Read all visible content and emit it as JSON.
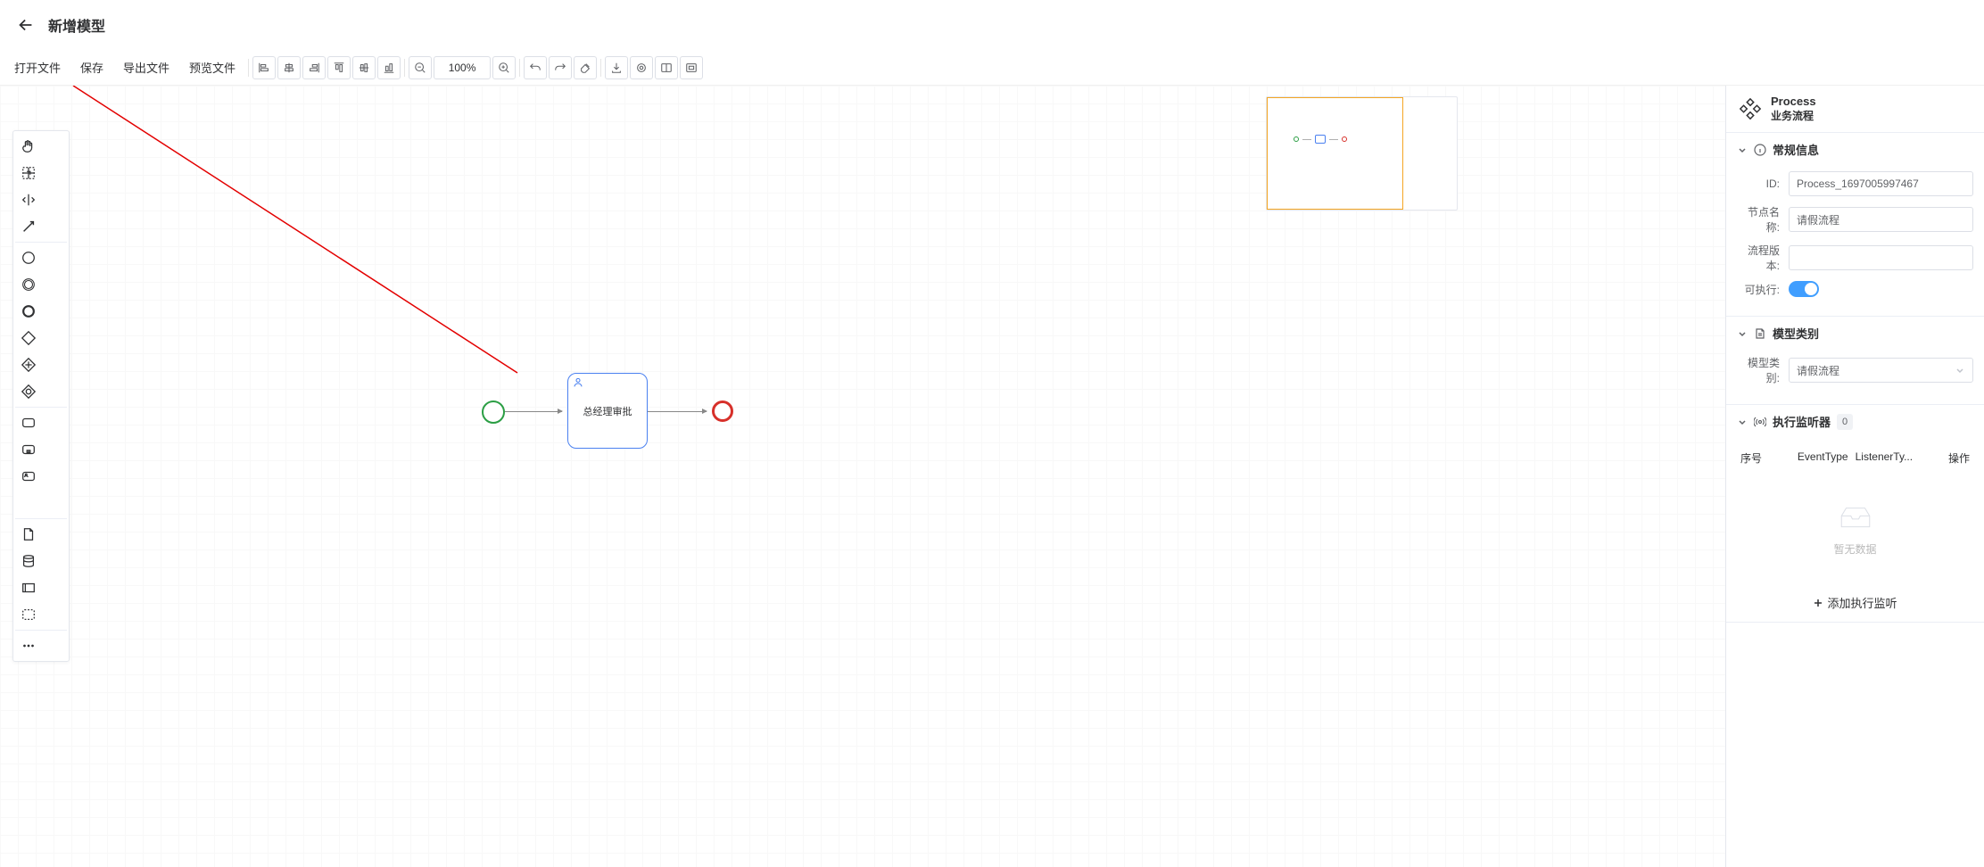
{
  "header": {
    "title": "新增模型"
  },
  "toolbar": {
    "open_file": "打开文件",
    "save": "保存",
    "export_file": "导出文件",
    "preview_file": "预览文件",
    "zoom": "100%"
  },
  "bpmn": {
    "task_label": "总经理审批"
  },
  "props": {
    "process_title": "Process",
    "process_subtitle": "业务流程",
    "section_general": "常规信息",
    "id_label": "ID:",
    "id_value": "Process_1697005997467",
    "name_label": "节点名称:",
    "name_value": "请假流程",
    "version_label": "流程版本:",
    "version_value": "",
    "executable_label": "可执行:",
    "executable_value": true,
    "section_category": "模型类别",
    "category_label": "模型类别:",
    "category_value": "请假流程",
    "section_listener": "执行监听器",
    "listener_count": "0",
    "listener_col_index": "序号",
    "listener_col_event": "EventType",
    "listener_col_type": "ListenerTy...",
    "listener_col_op": "操作",
    "listener_empty": "暂无数据",
    "add_listener": "添加执行监听"
  }
}
